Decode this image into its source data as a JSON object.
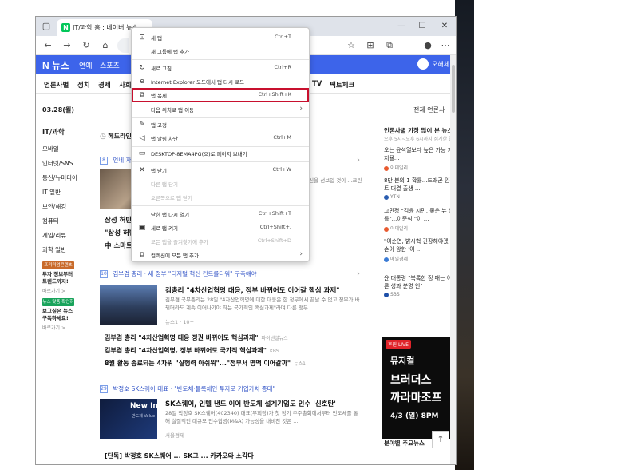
{
  "browser": {
    "tab_favicon": "N",
    "tab_title": "IT/과학 홈 : 네이버 뉴스",
    "tab_close": "×",
    "window_controls": {
      "minimize": "—",
      "maximize": "☐",
      "close": "✕"
    }
  },
  "toolbar": {
    "back": "←",
    "forward": "→",
    "refresh": "↻",
    "home": "⌂"
  },
  "naver": {
    "logo_n": "N",
    "logo_text": "뉴스",
    "nav_links": [
      "연예",
      "스포츠"
    ],
    "user_label": "오해체",
    "categories": [
      "언론사별",
      "정치",
      "경제",
      "사회",
      "TV",
      "팩트체크"
    ],
    "date": "03.28(월)",
    "press_all": "전체 언론사",
    "headline_label": "헤드라인",
    "sidebar": {
      "title": "IT/과학",
      "items": [
        "모바일",
        "인터넷/SNS",
        "통신/뉴미디어",
        "IT 일반",
        "보안/해킹",
        "컴퓨터",
        "게임/리뷰",
        "과학 일반"
      ],
      "promo1": {
        "badge": "프리미엄콘텐츠",
        "title": "투자 정보부터 트렌드까지!",
        "more": "바로가기 >"
      },
      "promo2": {
        "badge": "뉴스 맞춤 확인하기",
        "title": "보고싶은 뉴스 구독하세요!",
        "more": "바로가기 >"
      }
    }
  },
  "articles": [
    {
      "num": "8",
      "head": "언네 자",
      "title": "삼성 허반",
      "lines": [
        "\"삼성 허반",
        "中 스마트"
      ],
      "body": "...확신을 선보일 것이 ...크린 ..."
    },
    {
      "num": "10",
      "head": "김부겸 총리 · 새 정부 \"디지털 혁신 컨트롤타워\" 구축해야",
      "title": "김총리 \"4차산업혁명 대응, 정부 바뀌어도 이어갈 핵심 과제\"",
      "body": "김부겸 국무총리는 28일 \"4차산업혁명에 대한 대응은 한 정부에서 끝날 수 없고 정부가 바뀌더라도 계속 이어나가야 하는 국가적인 핵심과제\"라며 다른 정부 ...",
      "meta": "뉴스1 · 10+",
      "list": [
        {
          "text": "김부겸 총리 \"4차산업혁명 대응 정권 바뀌어도 핵심과제\"",
          "src": "파이낸셜뉴스"
        },
        {
          "text": "김부겸 총리 \"4차산업혁명, 정부 바뀌어도 국가적 핵심과제\"",
          "src": "KBS"
        },
        {
          "text": "8월 활동 종료되는 4차위 \"실행력 아쉬워\"...\"정부서 명맥 이어갈까\"",
          "src": "뉴스1"
        }
      ]
    },
    {
      "num": "29",
      "head": "박정호 SK스퀘어 대표 · \"반도체·블록체인 투자로 기업가치 증대\"",
      "title": "SK스퀘어, 인텔 낸드 이어 반도체 설계기업도 인수 '신호탄'",
      "body": "28일 박정호 SK스퀘어(402340) 대표(부회장)가 첫 정기 주주총회에서부터 반도체를 통해 실질적인 대규모 인수합병(M&A) 가능성을 내비친 것은 ...",
      "meta": "서울경제",
      "thumb_text1": "New In",
      "thumb_text2": "반도체 Value",
      "list": [
        {
          "text": "[단독] 박정호 SK스퀘어 ... SK그 ... 카카오와 소각다",
          "src": ""
        }
      ]
    }
  ],
  "right_panel": {
    "title": "언론사별 가장 많이 본 뉴스",
    "subtitle": "오후 5시~오후 6시까지 집계한 결과입니다.",
    "items": [
      {
        "text": "오는 윤석열보다 높은 가능 지지율...",
        "src": "이데일리",
        "color": "#e85a2f"
      },
      {
        "text": "8만 분의 1 확률...드래곤 임팩트 대결 출생 ...",
        "src": "YTN",
        "color": "#2a5db0"
      },
      {
        "text": "고민정 \"김윤 시민, 좋은 뉴 해를\"...이준석 \"이 ...",
        "src": "이데일리",
        "color": "#e85a2f"
      },
      {
        "text": "\"이순연, 밝시혁 긴장해야겠 큰 손이 왕한 '이 ...",
        "src": "매일경제",
        "color": "#3a7bd5"
      },
      {
        "text": "윤 대통령 \"복록한 정 패는 이른 성과 분명 인\"",
        "src": "SBS",
        "color": "#1d4fa8"
      }
    ],
    "ad": {
      "badge": "후원 LIVE",
      "line1": "뮤지컬",
      "line2": "브러더스",
      "line3": "까라마조프",
      "line4": "4/3 (일) 8PM"
    },
    "bottom_title": "분야별 주요뉴스",
    "scroll_top": "↑"
  },
  "context_menu": {
    "items": [
      {
        "icon": "⊡",
        "label": "새 탭",
        "shortcut": "Ctrl+T"
      },
      {
        "icon": "",
        "label": "새 그룹에 탭 추가",
        "shortcut": ""
      },
      {
        "icon": "↻",
        "label": "새로 고침",
        "shortcut": "Ctrl+R"
      },
      {
        "icon": "",
        "label": "Internet Explorer 모드에서 탭 다시 로드",
        "shortcut": ""
      },
      {
        "icon": "⧉",
        "label": "탭 복제",
        "shortcut": "Ctrl+Shift+K"
      },
      {
        "icon": "",
        "label": "다음 위치로 탭 이동",
        "shortcut": ""
      },
      {
        "icon": "✎",
        "label": "탭 고정",
        "shortcut": ""
      },
      {
        "icon": "◁",
        "label": "탭 알림 차단",
        "shortcut": "Ctrl+M"
      },
      {
        "icon": "▭",
        "label": "DESKTOP-8EMA4PG(으)로 페이지 보내기",
        "shortcut": ""
      },
      {
        "icon": "✕",
        "label": "탭 닫기",
        "shortcut": "Ctrl+W"
      },
      {
        "icon": "",
        "label": "다른 탭 닫기",
        "shortcut": ""
      },
      {
        "icon": "",
        "label": "오른쪽으로 탭 닫기",
        "shortcut": ""
      },
      {
        "icon": "",
        "label": "닫힌 탭 다시 열기",
        "shortcut": "Ctrl+Shift+T"
      },
      {
        "icon": "▣",
        "label": "세로 탭 켜기",
        "shortcut": "Ctrl+Shift+,"
      },
      {
        "icon": "",
        "label": "모든 탭을 즐겨찾기에 추가",
        "shortcut": "Ctrl+Shift+D"
      },
      {
        "icon": "⧉",
        "label": "컬렉션에 모든 탭 추가",
        "shortcut": ""
      }
    ],
    "submenu_arrow": "›",
    "highlight_color": "#c8102e"
  }
}
